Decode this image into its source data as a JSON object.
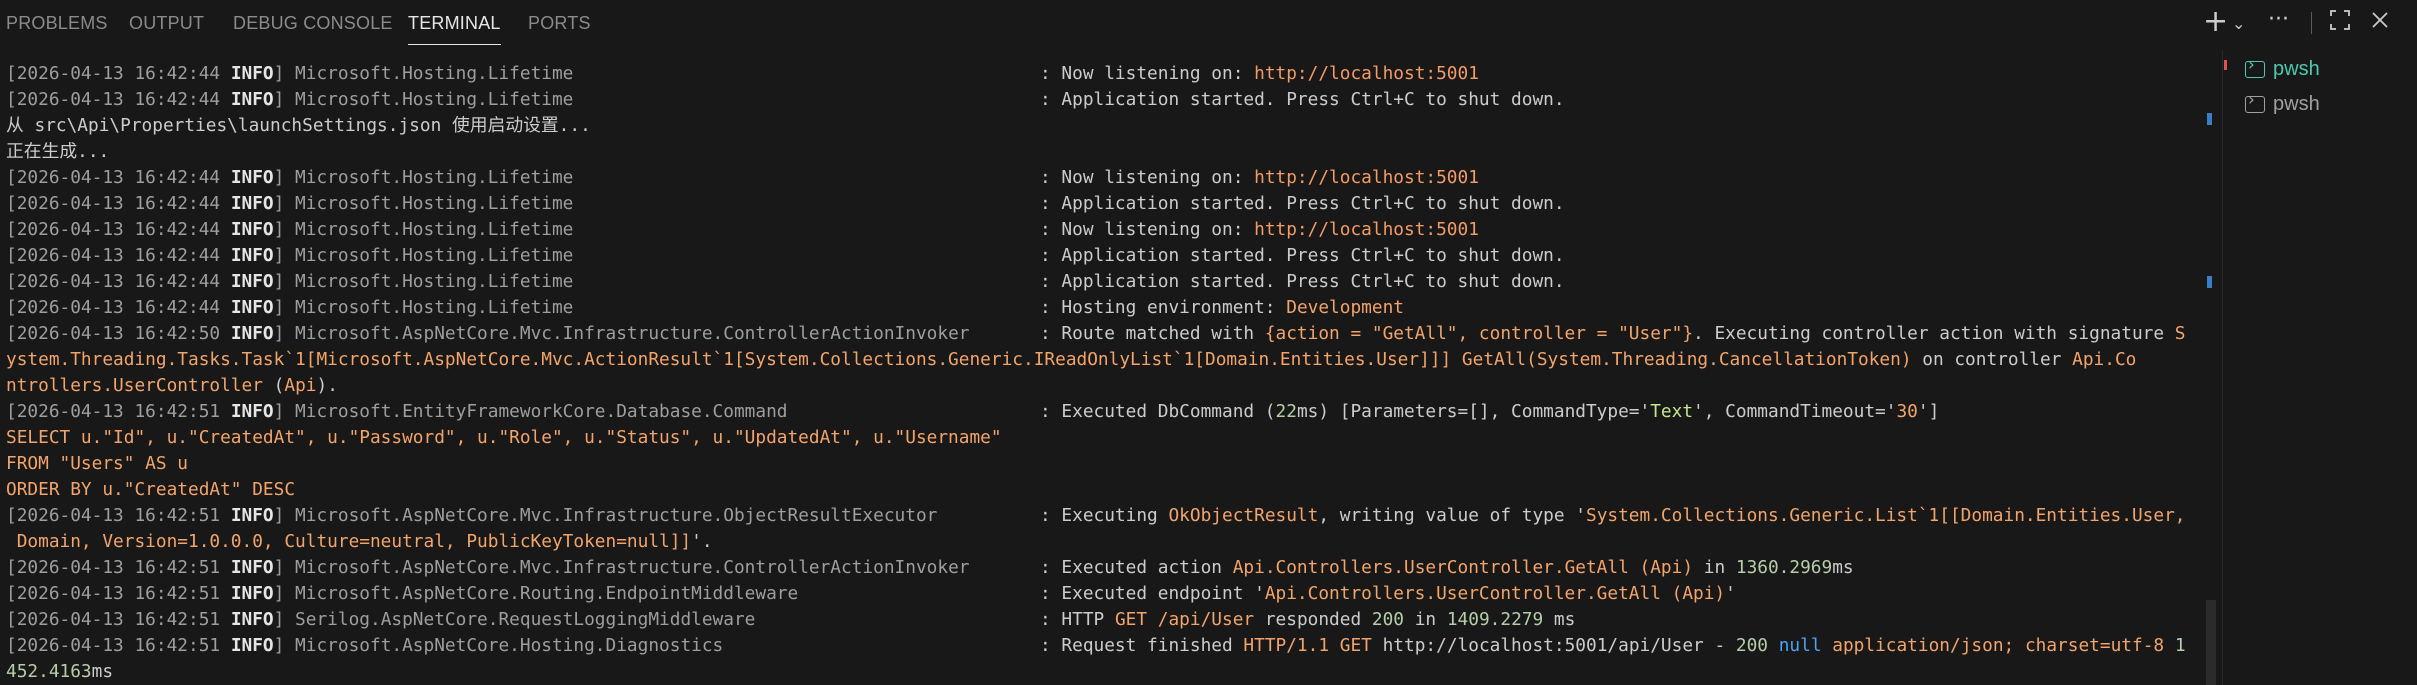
{
  "panel": {
    "tabs": [
      {
        "label": "PROBLEMS"
      },
      {
        "label": "OUTPUT"
      },
      {
        "label": "DEBUG CONSOLE"
      },
      {
        "label": "TERMINAL"
      },
      {
        "label": "PORTS"
      }
    ],
    "active_tab": "TERMINAL",
    "icons": {
      "new": "plus-icon",
      "dropdown": "chevron-down-icon",
      "more": "ellipsis-icon",
      "maximize": "maximize-icon",
      "close": "close-icon"
    }
  },
  "terminal_sessions": [
    {
      "label": "pwsh",
      "active": true
    },
    {
      "label": "pwsh",
      "active": false
    }
  ],
  "terminal": {
    "l1": {
      "ts": "[2026-04-13 16:42:44 ",
      "lvl": "INFO",
      "src": "] Microsoft.Hosting.Lifetime",
      "msg": ": Now listening on: ",
      "url": "http://localhost:5001"
    },
    "l2": {
      "ts": "[2026-04-13 16:42:44 ",
      "lvl": "INFO",
      "src": "] Microsoft.Hosting.Lifetime",
      "msg": ": Application started. Press Ctrl+C to shut down."
    },
    "l3": "从 src\\Api\\Properties\\launchSettings.json 使用启动设置...",
    "l4": "正在生成...",
    "l5": {
      "ts": "[2026-04-13 16:42:44 ",
      "lvl": "INFO",
      "src": "] Microsoft.Hosting.Lifetime",
      "msg": ": Now listening on: ",
      "url": "http://localhost:5001"
    },
    "l6": {
      "ts": "[2026-04-13 16:42:44 ",
      "lvl": "INFO",
      "src": "] Microsoft.Hosting.Lifetime",
      "msg": ": Application started. Press Ctrl+C to shut down."
    },
    "l7": {
      "ts": "[2026-04-13 16:42:44 ",
      "lvl": "INFO",
      "src": "] Microsoft.Hosting.Lifetime",
      "msg": ": Now listening on: ",
      "url": "http://localhost:5001"
    },
    "l8": {
      "ts": "[2026-04-13 16:42:44 ",
      "lvl": "INFO",
      "src": "] Microsoft.Hosting.Lifetime",
      "msg": ": Application started. Press Ctrl+C to shut down."
    },
    "l9": {
      "ts": "[2026-04-13 16:42:44 ",
      "lvl": "INFO",
      "src": "] Microsoft.Hosting.Lifetime",
      "msg": ": Application started. Press Ctrl+C to shut down."
    },
    "l10": {
      "ts": "[2026-04-13 16:42:44 ",
      "lvl": "INFO",
      "src": "] Microsoft.Hosting.Lifetime",
      "msg": ": Hosting environment: ",
      "env": "Development"
    },
    "l11": {
      "ts": "[2026-04-13 16:42:50 ",
      "lvl": "INFO",
      "src": "] Microsoft.AspNetCore.Mvc.Infrastructure.ControllerActionInvoker",
      "msg": ": Route matched with ",
      "route": "{action = \"GetAll\", controller = \"User\"}",
      "msg2": ". Executing controller action with signature ",
      "sig": "S"
    },
    "l12": {
      "a": "ystem.Threading.Tasks.Task`1[Microsoft.AspNetCore.Mvc.ActionResult`1[System.Collections.Generic.IReadOnlyList`1[Domain.Entities.User]]] GetAll(System.Threading.CancellationToken)",
      "b": " on controller ",
      "c": "Api.Co"
    },
    "l13": {
      "a": "ntrollers.UserController",
      "b": " (",
      "c": "Api",
      "d": ")."
    },
    "l14": {
      "ts": "[2026-04-13 16:42:51 ",
      "lvl": "INFO",
      "src": "] Microsoft.EntityFrameworkCore.Database.Command",
      "msg": ": Executed DbCommand (",
      "n": "22",
      "msg2": "ms) [Parameters=[], CommandType='",
      "t": "Text",
      "msg3": "', CommandTimeout='",
      "to": "30",
      "msg4": "']"
    },
    "l15": "SELECT u.\"Id\", u.\"CreatedAt\", u.\"Password\", u.\"Role\", u.\"Status\", u.\"UpdatedAt\", u.\"Username\"",
    "l16": "FROM \"Users\" AS u",
    "l17": "ORDER BY u.\"CreatedAt\" DESC",
    "l18": {
      "ts": "[2026-04-13 16:42:51 ",
      "lvl": "INFO",
      "src": "] Microsoft.AspNetCore.Mvc.Infrastructure.ObjectResultExecutor",
      "msg": ": Executing ",
      "r": "OkObjectResult",
      "msg2": ", writing value of type '",
      "ty": "System.Collections.Generic.List`1[[Domain.Entities.User,"
    },
    "l19": {
      "a": " Domain, Version=1.0.0.0, Culture=neutral, PublicKeyToken=null]]",
      "b": "'."
    },
    "l20": {
      "ts": "[2026-04-13 16:42:51 ",
      "lvl": "INFO",
      "src": "] Microsoft.AspNetCore.Mvc.Infrastructure.ControllerActionInvoker",
      "msg": ": Executed action ",
      "a": "Api.Controllers.UserController.GetAll (Api)",
      "msg2": " in ",
      "n": "1360.2969",
      "msg3": "ms"
    },
    "l21": {
      "ts": "[2026-04-13 16:42:51 ",
      "lvl": "INFO",
      "src": "] Microsoft.AspNetCore.Routing.EndpointMiddleware",
      "msg": ": Executed endpoint '",
      "a": "Api.Controllers.UserController.GetAll (Api)",
      "msg2": "'"
    },
    "l22": {
      "ts": "[2026-04-13 16:42:51 ",
      "lvl": "INFO",
      "src": "] Serilog.AspNetCore.RequestLoggingMiddleware",
      "msg": ": HTTP ",
      "m": "GET",
      "p": " /api/User",
      "msg2": " responded ",
      "s": "200",
      "msg3": " in ",
      "n": "1409.2279",
      "msg4": " ms"
    },
    "l23": {
      "ts": "[2026-04-13 16:42:51 ",
      "lvl": "INFO",
      "src": "] Microsoft.AspNetCore.Hosting.Diagnostics",
      "msg": ": Request finished ",
      "h": "HTTP/1.1",
      "m": " GET ",
      "u": "http://localhost:5001/api/User",
      "d": " - ",
      "s": "200",
      "nl": " null ",
      "ct": "application/json; charset=utf-8 ",
      "n": "1"
    },
    "l24": {
      "n": "452.4163",
      "u": "ms"
    }
  },
  "colors": {
    "background": "#181818",
    "accent": "#4ec9b0",
    "string": "#f2a46b",
    "number": "#b5cea8"
  }
}
